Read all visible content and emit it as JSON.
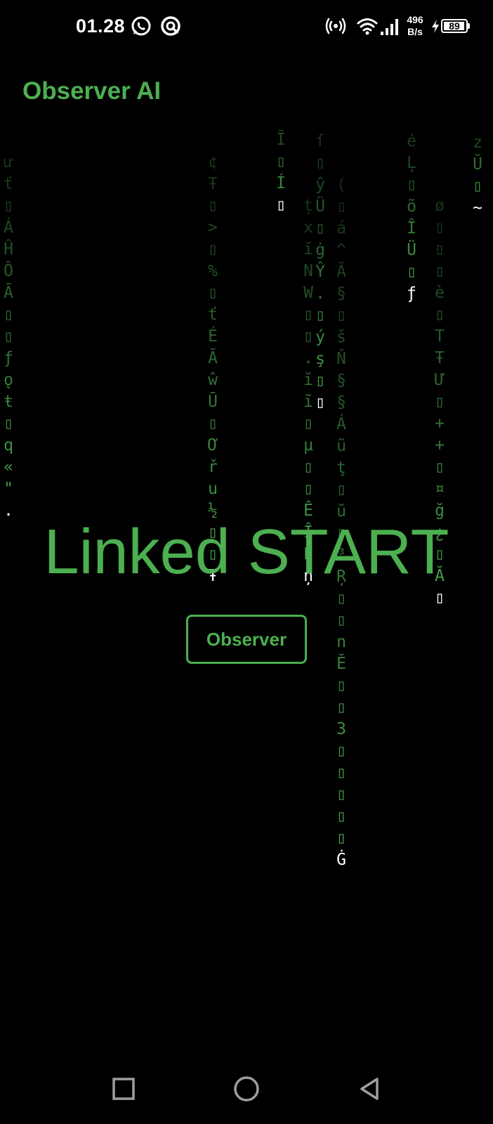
{
  "status_bar": {
    "time": "01.28",
    "net_speed_value": "496",
    "net_speed_unit": "B/s",
    "battery_level": "89",
    "icons": [
      "whatsapp-icon",
      "app-notification-icon",
      "hotspot-icon",
      "wifi-icon",
      "signal-icon",
      "charging-icon",
      "battery-icon"
    ]
  },
  "app_bar": {
    "title": "Observer AI"
  },
  "main": {
    "hero_title": "Linked START",
    "button_label": "Observer"
  },
  "matrix_rain": {
    "columns": [
      {
        "chars": [
          "ư",
          "ť",
          "",
          "Á",
          "Ĥ",
          "Ô",
          "Ā",
          "",
          "",
          "ƒ",
          "ǫ",
          "ŧ",
          "",
          "q",
          "«",
          "\"",
          "."
        ]
      },
      {
        "chars": [
          "¢",
          "Ŧ",
          "",
          ">",
          "",
          "%",
          "",
          "ť",
          "É",
          "Ă",
          "ŵ",
          "Ū",
          "",
          "Ơ",
          "ř",
          "u",
          "½",
          "",
          "",
          "Ŧ"
        ]
      },
      {
        "chars": [
          "Ĩ",
          "",
          "Í",
          ""
        ]
      },
      {
        "chars": [
          "ț",
          "x",
          "ĭ",
          "N",
          "W",
          "",
          "",
          ".",
          "ĭ",
          "ĩ",
          "",
          "µ",
          "",
          "",
          "Ê",
          "Î",
          "Ę",
          "ņ"
        ]
      },
      {
        "chars": [
          "ſ",
          "",
          "ŷ",
          "Ü",
          "",
          "ġ",
          "Ŷ",
          ".",
          "",
          "ý",
          "ş",
          "",
          ""
        ]
      },
      {
        "chars": [
          "(",
          "",
          "á",
          "^",
          "Ă",
          "§",
          "",
          "š",
          "Ň",
          "§",
          "§",
          "Á",
          "ũ",
          "ţ",
          "",
          "ŭ",
          "",
          "³",
          "Ŗ",
          "",
          "",
          "n",
          "Ĕ",
          "",
          "",
          "3",
          "",
          "",
          "",
          "",
          "",
          "Ġ"
        ]
      },
      {
        "chars": [
          "ė",
          "Ļ",
          "",
          "õ",
          "Î",
          "Ü",
          "",
          "ƒ"
        ]
      },
      {
        "chars": [
          "ø",
          "",
          "",
          "",
          "è",
          "",
          "T",
          "Ŧ",
          "Ư",
          "",
          "+",
          "+",
          "",
          "¤",
          "ğ",
          "¿",
          "",
          "Ă",
          ""
        ]
      },
      {
        "chars": [
          "z",
          "Ŭ",
          "",
          "~"
        ]
      }
    ]
  },
  "nav_bar": {
    "icons": [
      "recents-square-icon",
      "home-circle-icon",
      "back-triangle-icon"
    ]
  }
}
